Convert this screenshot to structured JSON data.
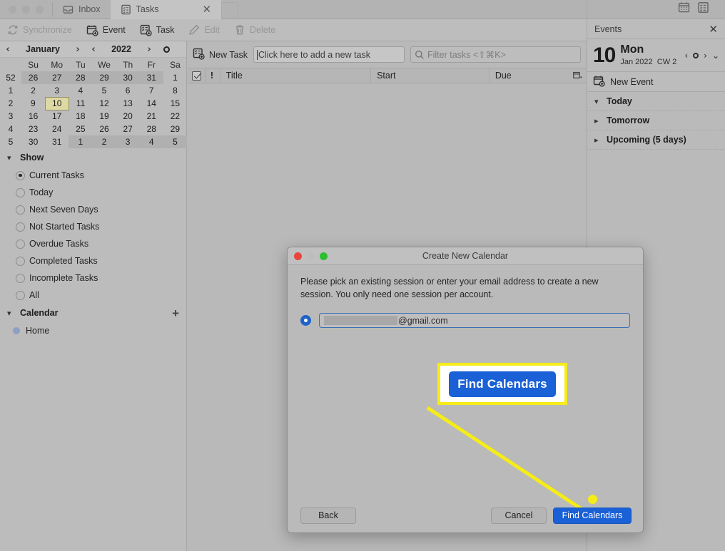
{
  "window": {
    "tabs": [
      {
        "label": "Inbox",
        "icon": "inbox-icon",
        "active": false
      },
      {
        "label": "Tasks",
        "icon": "task-list-icon",
        "active": true
      }
    ],
    "close_glyph": "✕"
  },
  "toolbar": {
    "items": [
      {
        "label": "Synchronize",
        "icon": "sync-icon",
        "disabled": true
      },
      {
        "label": "Event",
        "icon": "calendar-add-icon",
        "disabled": false
      },
      {
        "label": "Task",
        "icon": "task-add-icon",
        "disabled": false
      },
      {
        "label": "Edit",
        "icon": "pencil-icon",
        "disabled": true
      },
      {
        "label": "Delete",
        "icon": "trash-icon",
        "disabled": true
      }
    ],
    "menu_icon": "hamburger-menu-icon"
  },
  "sidebar": {
    "calendar": {
      "month": "January",
      "year": "2022",
      "prev_glyph": "‹",
      "next_glyph": "›",
      "weekday_headers": [
        "Su",
        "Mo",
        "Tu",
        "We",
        "Th",
        "Fr",
        "Sa"
      ],
      "selected_day": "10",
      "weeks": [
        {
          "wk": "52",
          "days": [
            {
              "d": "26",
              "out": true
            },
            {
              "d": "27",
              "out": true
            },
            {
              "d": "28",
              "out": true
            },
            {
              "d": "29",
              "out": true
            },
            {
              "d": "30",
              "out": true
            },
            {
              "d": "31",
              "out": true
            },
            {
              "d": "1",
              "out": false
            }
          ]
        },
        {
          "wk": "1",
          "days": [
            {
              "d": "2",
              "out": false
            },
            {
              "d": "3",
              "out": false
            },
            {
              "d": "4",
              "out": false
            },
            {
              "d": "5",
              "out": false
            },
            {
              "d": "6",
              "out": false
            },
            {
              "d": "7",
              "out": false
            },
            {
              "d": "8",
              "out": false
            }
          ]
        },
        {
          "wk": "2",
          "days": [
            {
              "d": "9",
              "out": false
            },
            {
              "d": "10",
              "out": false,
              "sel": true
            },
            {
              "d": "11",
              "out": false
            },
            {
              "d": "12",
              "out": false
            },
            {
              "d": "13",
              "out": false
            },
            {
              "d": "14",
              "out": false
            },
            {
              "d": "15",
              "out": false
            }
          ]
        },
        {
          "wk": "3",
          "days": [
            {
              "d": "16",
              "out": false
            },
            {
              "d": "17",
              "out": false
            },
            {
              "d": "18",
              "out": false
            },
            {
              "d": "19",
              "out": false
            },
            {
              "d": "20",
              "out": false
            },
            {
              "d": "21",
              "out": false
            },
            {
              "d": "22",
              "out": false
            }
          ]
        },
        {
          "wk": "4",
          "days": [
            {
              "d": "23",
              "out": false
            },
            {
              "d": "24",
              "out": false
            },
            {
              "d": "25",
              "out": false
            },
            {
              "d": "26",
              "out": false
            },
            {
              "d": "27",
              "out": false
            },
            {
              "d": "28",
              "out": false
            },
            {
              "d": "29",
              "out": false
            }
          ]
        },
        {
          "wk": "5",
          "days": [
            {
              "d": "30",
              "out": false
            },
            {
              "d": "31",
              "out": false
            },
            {
              "d": "1",
              "out": true
            },
            {
              "d": "2",
              "out": true
            },
            {
              "d": "3",
              "out": true
            },
            {
              "d": "4",
              "out": true
            },
            {
              "d": "5",
              "out": true
            }
          ]
        }
      ]
    },
    "show": {
      "title": "Show",
      "options": [
        {
          "label": "Current Tasks",
          "selected": true
        },
        {
          "label": "Today",
          "selected": false
        },
        {
          "label": "Next Seven Days",
          "selected": false
        },
        {
          "label": "Not Started Tasks",
          "selected": false
        },
        {
          "label": "Overdue Tasks",
          "selected": false
        },
        {
          "label": "Completed Tasks",
          "selected": false
        },
        {
          "label": "Incomplete Tasks",
          "selected": false
        },
        {
          "label": "All",
          "selected": false
        }
      ]
    },
    "calendars": {
      "title": "Calendar",
      "add_glyph": "+",
      "items": [
        {
          "label": "Home",
          "color": "#8e9fc4"
        }
      ]
    }
  },
  "tasks": {
    "new_task_label": "New Task",
    "new_task_placeholder": "Click here to add a new task",
    "filter_placeholder": "Filter tasks <⇧⌘K>",
    "columns": [
      "Title",
      "Start",
      "Due"
    ],
    "rows": []
  },
  "events": {
    "panel_title": "Events",
    "close_glyph": "✕",
    "day_number": "10",
    "day_of_week": "Mon",
    "month_year": "Jan 2022",
    "week_label": "CW 2",
    "prev_glyph": "‹",
    "next_glyph": "›",
    "expand_glyph": "⌄",
    "new_event_label": "New Event",
    "groups": [
      {
        "label": "Today",
        "expanded": true
      },
      {
        "label": "Tomorrow",
        "expanded": false
      },
      {
        "label": "Upcoming (5 days)",
        "expanded": false
      }
    ]
  },
  "dialog": {
    "title": "Create New Calendar",
    "description": "Please pick an existing session or enter your email address to create a new session. You only need one session per account.",
    "email_value": "@gmail.com",
    "email_redacted": true,
    "callout_label": "Find Calendars",
    "buttons": {
      "back": "Back",
      "cancel": "Cancel",
      "primary": "Find Calendars"
    }
  },
  "colors": {
    "accent_blue": "#1a60d6",
    "highlight_yellow": "#f5ec18",
    "selected_day": "#ded9a4",
    "calendar_home": "#8e9fc4"
  }
}
